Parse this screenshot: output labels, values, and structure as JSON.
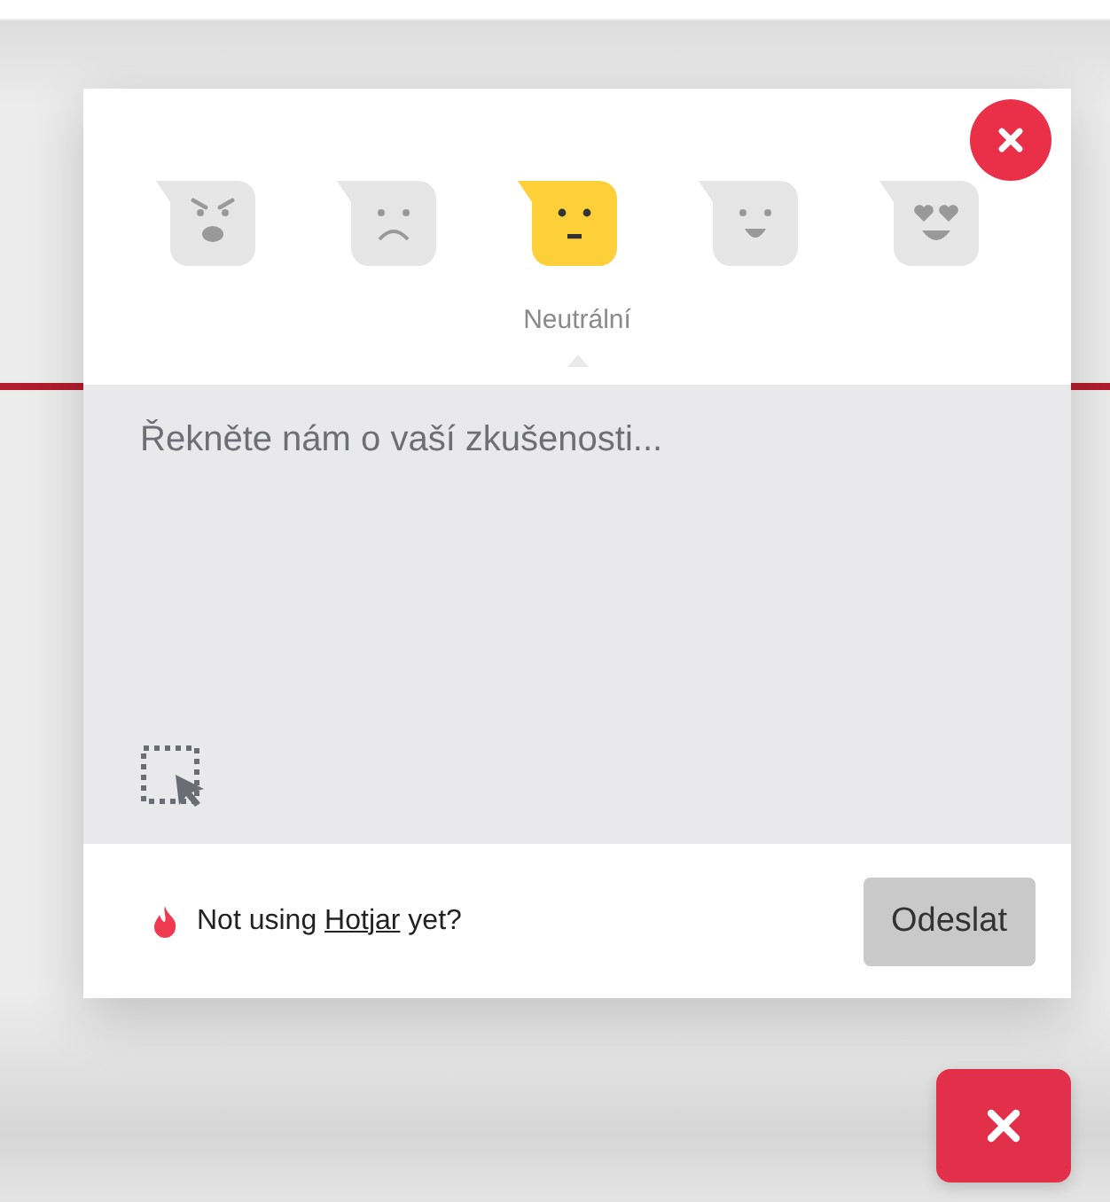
{
  "ratings": [
    {
      "kind": "angry",
      "selected": false
    },
    {
      "kind": "sad",
      "selected": false
    },
    {
      "kind": "neutral",
      "selected": true
    },
    {
      "kind": "happy",
      "selected": false
    },
    {
      "kind": "love",
      "selected": false
    }
  ],
  "rating_label": "Neutrální",
  "feedback": {
    "placeholder": "Řekněte nám o vaší zkušenosti..."
  },
  "promo": {
    "before": "Not using",
    "link": "Hotjar",
    "after": "yet?"
  },
  "submit": "Odeslat"
}
